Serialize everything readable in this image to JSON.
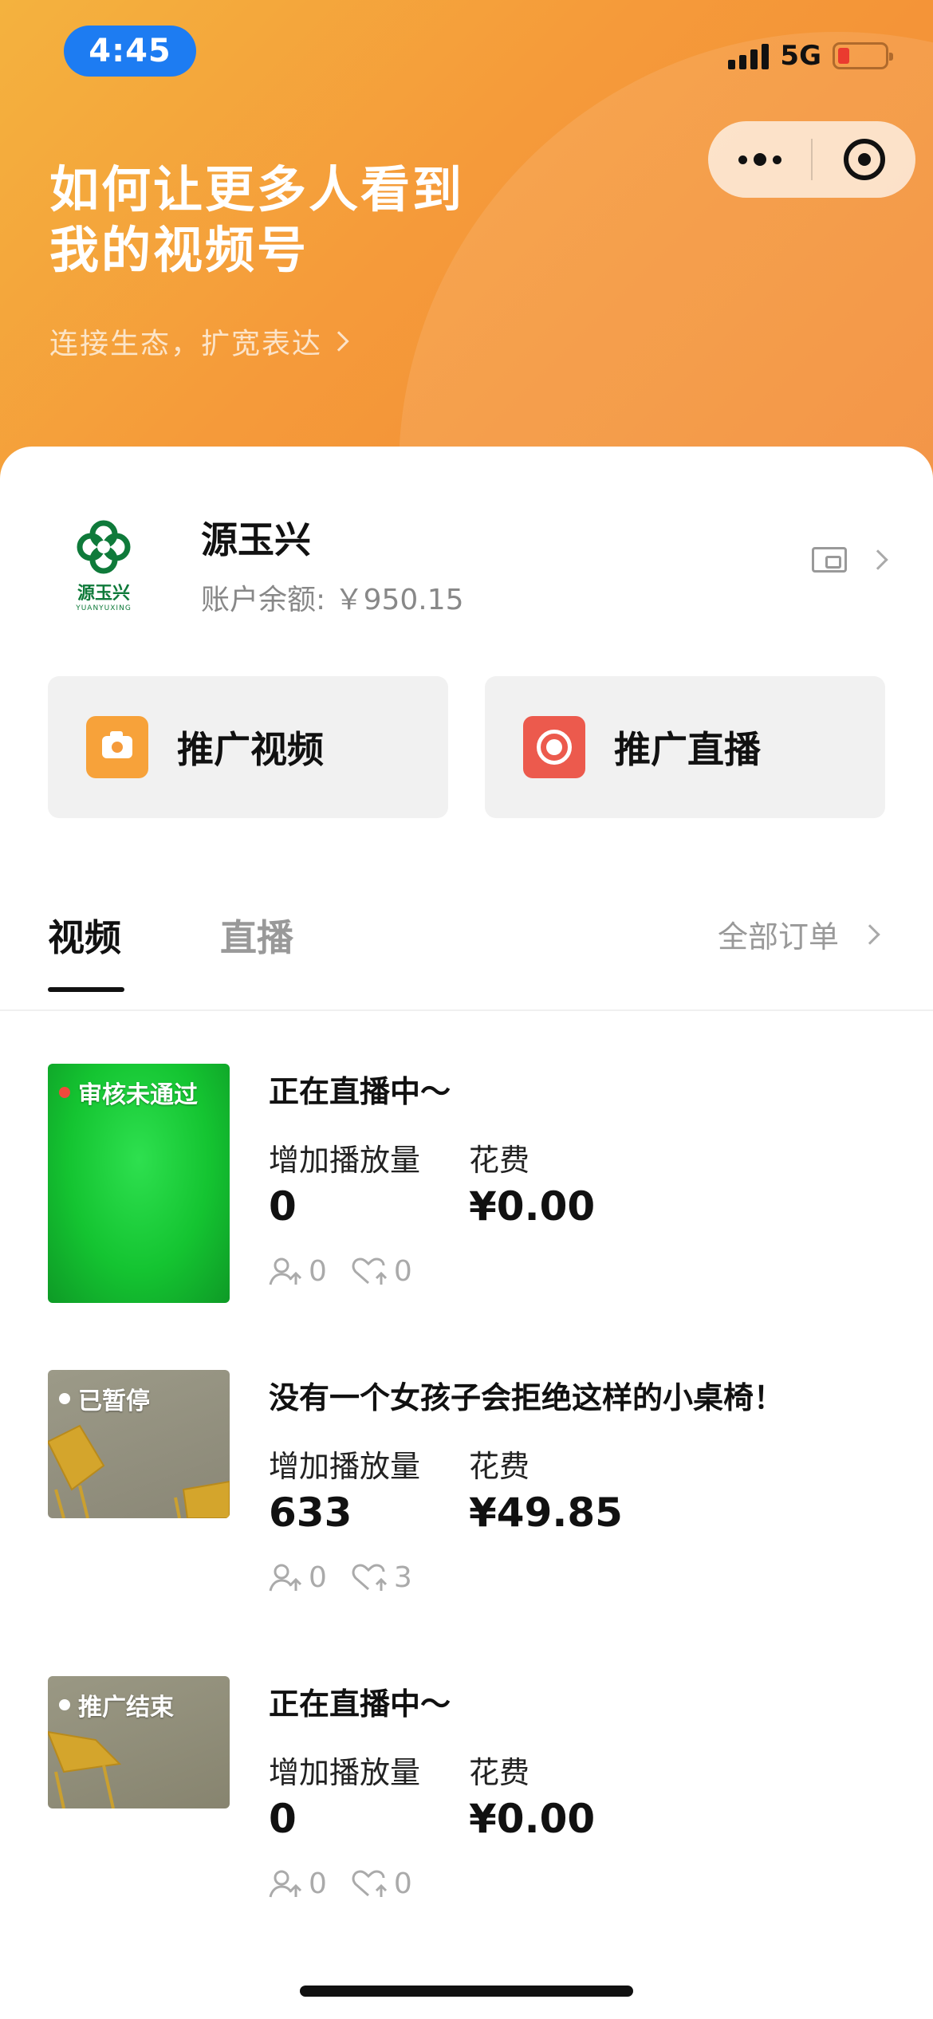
{
  "status_bar": {
    "time": "4:45",
    "network": "5G"
  },
  "hero": {
    "title_line1": "如何让更多人看到",
    "title_line2": "我的视频号",
    "subtitle": "连接生态，扩宽表达"
  },
  "account": {
    "logo_cn": "源玉兴",
    "logo_en": "YUANYUXING",
    "name": "源玉兴",
    "balance_label": "账户余额:",
    "balance_value": "￥950.15"
  },
  "promo_buttons": [
    {
      "label": "推广视频",
      "icon": "camera-icon",
      "color": "#f7a23a"
    },
    {
      "label": "推广直播",
      "icon": "record-icon",
      "color": "#ec5a4d"
    }
  ],
  "tabs": {
    "items": [
      {
        "label": "视频"
      },
      {
        "label": "直播"
      }
    ],
    "active": "视频",
    "all_orders": "全部订单"
  },
  "orders": [
    {
      "status": "审核未通过",
      "status_color": "#f04a3c",
      "title": "正在直播中～",
      "views_label": "增加播放量",
      "views": "0",
      "cost_label": "花费",
      "cost": "¥0.00",
      "follows": "0",
      "likes": "0"
    },
    {
      "status": "已暂停",
      "status_color": "#ffffff",
      "title": "没有一个女孩子会拒绝这样的小桌椅！",
      "views_label": "增加播放量",
      "views": "633",
      "cost_label": "花费",
      "cost": "¥49.85",
      "follows": "0",
      "likes": "3"
    },
    {
      "status": "推广结束",
      "status_color": "#ffffff",
      "title": "正在直播中～",
      "views_label": "增加播放量",
      "views": "0",
      "cost_label": "花费",
      "cost": "¥0.00",
      "follows": "0",
      "likes": "0"
    }
  ],
  "colors": {
    "accent_orange": "#f59a3a",
    "live_red": "#ec5a4d",
    "reject_green": "#16c83a"
  }
}
